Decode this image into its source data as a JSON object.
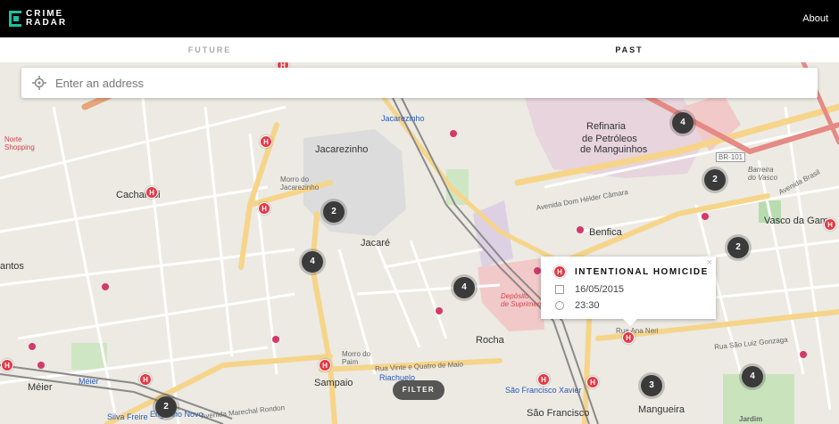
{
  "header": {
    "logo_line1": "CRIME",
    "logo_line2": "RADAR",
    "about_label": "About"
  },
  "tabs": [
    {
      "label": "FUTURE"
    },
    {
      "label": "PAST"
    }
  ],
  "search": {
    "placeholder": "Enter an address"
  },
  "clusters": [
    {
      "count": "4"
    },
    {
      "count": "2"
    },
    {
      "count": "2"
    },
    {
      "count": "4"
    },
    {
      "count": "4"
    },
    {
      "count": "2"
    },
    {
      "count": "3"
    },
    {
      "count": "4"
    },
    {
      "count": "2"
    }
  ],
  "popup": {
    "title": "INTENTIONAL HOMICIDE",
    "date": "16/05/2015",
    "time": "23:30",
    "close": "×"
  },
  "filter_label": "FILTER",
  "map_labels": {
    "refinaria": "Refinaria",
    "refinaria2": "de Petróleos",
    "refinaria3": "de Manguinhos",
    "jacarezinho": "Jacarezinho",
    "jacarezinho_blue": "Jacarezinho",
    "jacare": "Jacaré",
    "benfica": "Benfica",
    "rocha": "Rocha",
    "cachambi": "Cachambi",
    "meier": "Méier",
    "mangueira": "Mangueira",
    "sampaio": "Sampaio",
    "engenho_novo": "Engenho Novo",
    "silva_freire": "Silva Freire",
    "vasco": "Vasco da Gama",
    "norte_shopping": "Norte\nShopping",
    "santos": "antos",
    "morro_jacarezinho": "Morro do\nJacarezinho",
    "deposito": "Depósito\nde Suprimento",
    "sao_francisco": "São Francisco Xavier",
    "riachuelo": "Riachuelo",
    "br101": "BR-101",
    "barreira": "Barreira\ndo Vasco",
    "av_brasil": "Avenida Brasil",
    "av_dom_helder": "Avenida Dom Hélder Câmara",
    "rua_ana_neri": "Rua Ana Neri",
    "av_marechal": "Avenida Marechal Rondon",
    "rua_24_maio": "Rua Vinte e Quatro de Maio",
    "rua_sao_luiz": "Rua São Luiz Gonzaga",
    "jardim": "Jardim",
    "meier_blue": "Méier",
    "morro_paim": "Morro do\nPaim",
    "sao_francisco2": "São Francisco"
  }
}
